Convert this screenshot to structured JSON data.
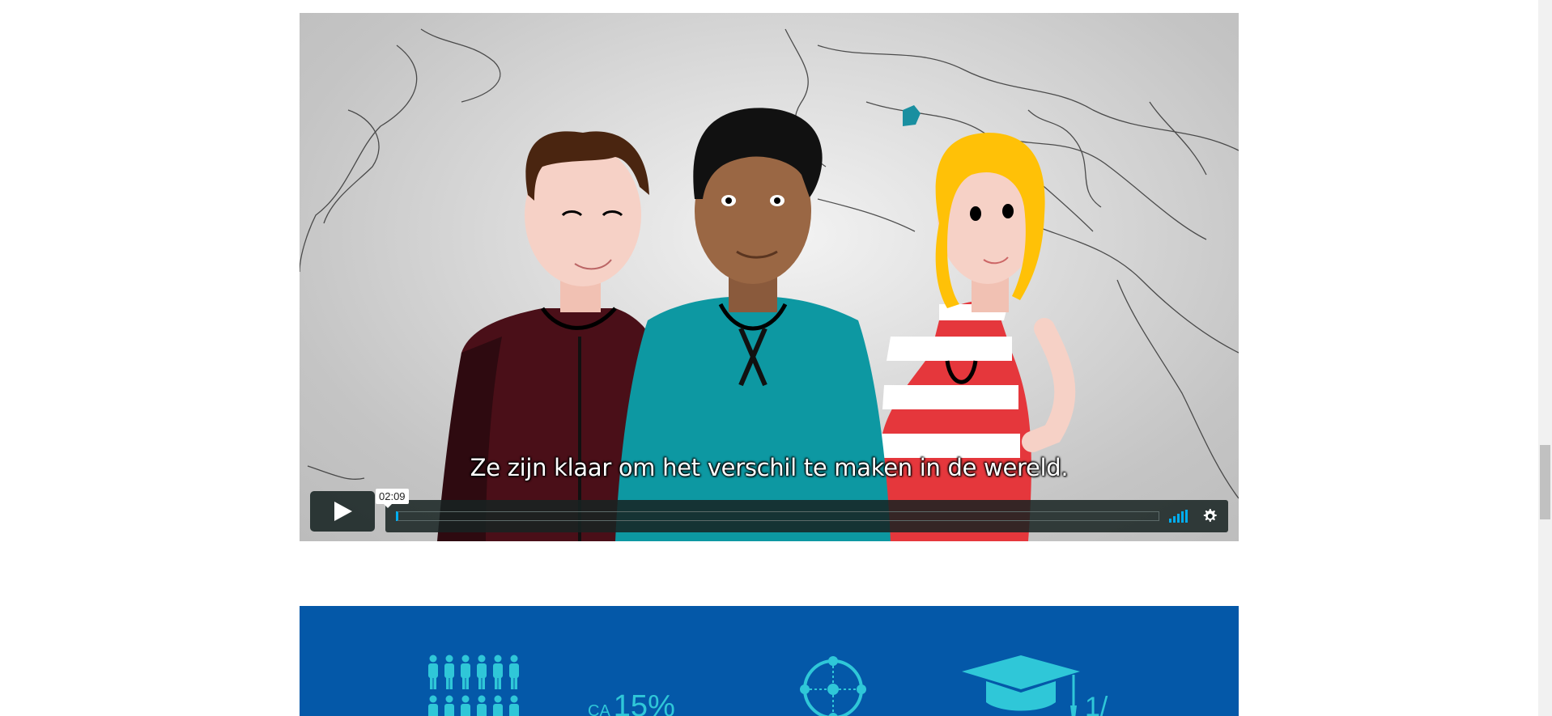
{
  "video": {
    "subtitle": "Ze zijn klaar om het verschil te maken in de wereld.",
    "time_tooltip": "02:09",
    "progress": 0.002,
    "accent_color": "#00adef",
    "icons": {
      "play": "play-icon",
      "volume": "volume-icon",
      "settings": "gear-icon"
    }
  },
  "stats": {
    "background_color": "#0458a8",
    "accent_color": "#2fc7d8",
    "items": [
      {
        "icon": "people-icon",
        "prefix": "CA",
        "value": "15%"
      },
      {
        "icon": "network-icon"
      },
      {
        "icon": "graduation-cap-icon",
        "value": "1/"
      }
    ]
  }
}
